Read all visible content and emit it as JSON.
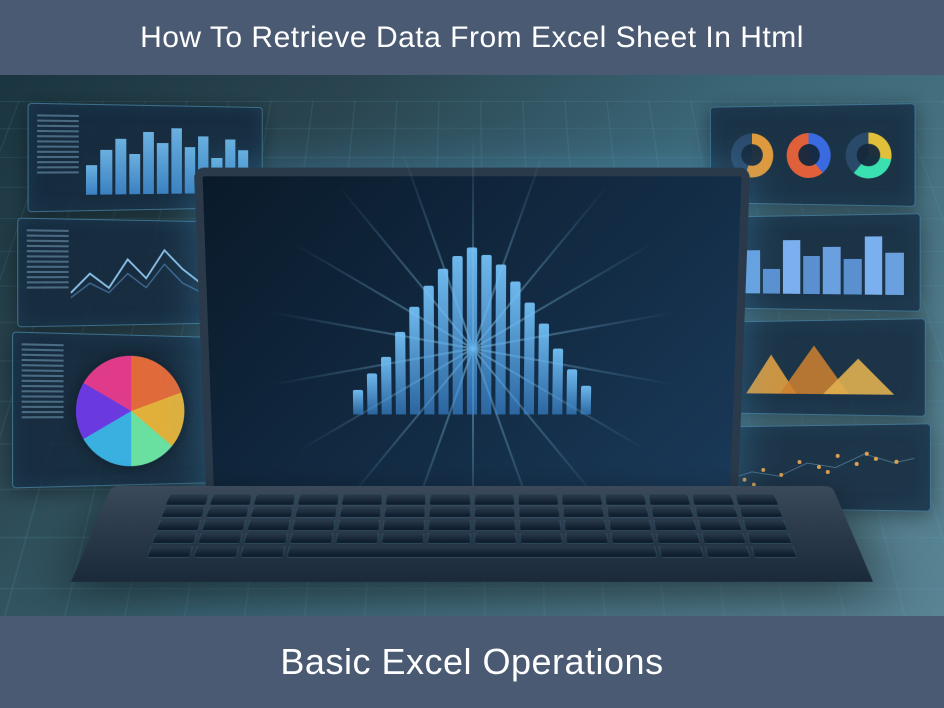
{
  "header": {
    "title": "How To Retrieve Data From Excel Sheet In Html"
  },
  "footer": {
    "title": "Basic Excel Operations"
  },
  "colors": {
    "banner_bg": "#4a5a72",
    "banner_text": "#ffffff"
  }
}
